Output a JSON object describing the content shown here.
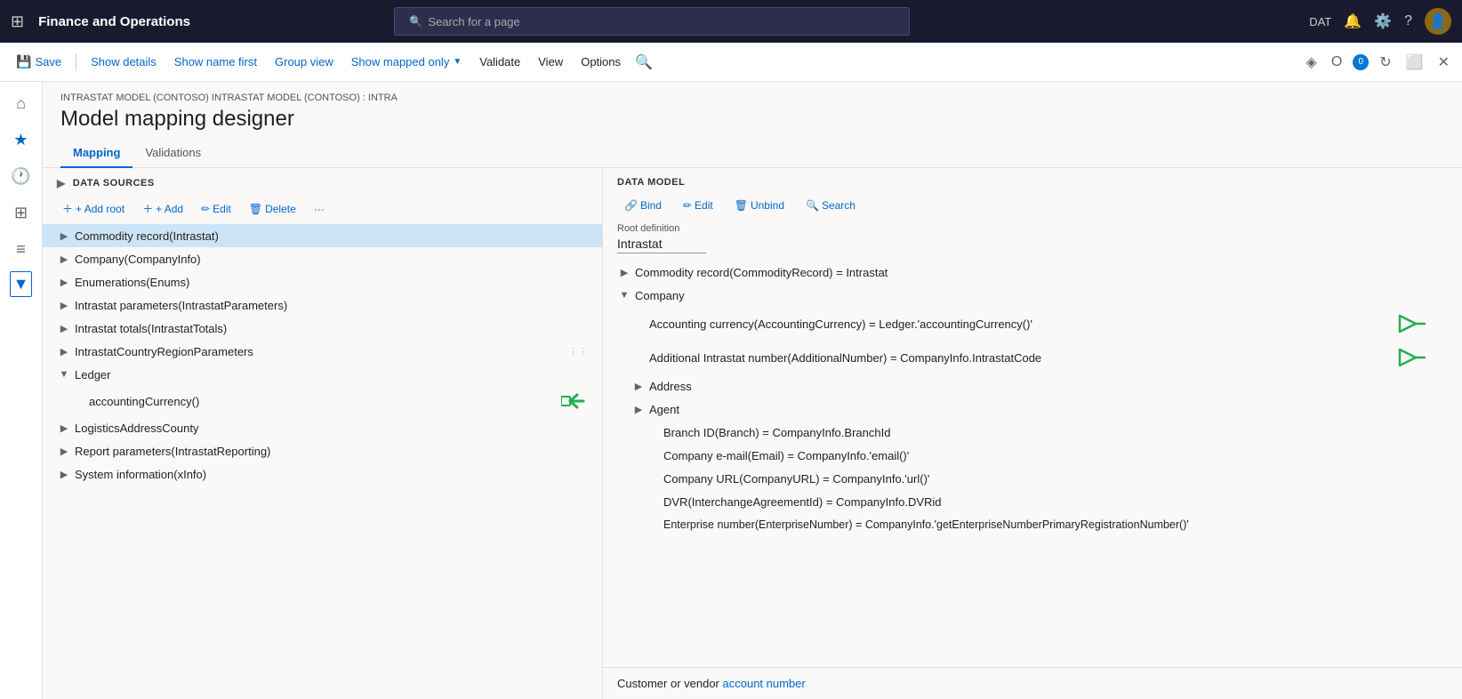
{
  "app": {
    "title": "Finance and Operations",
    "search_placeholder": "Search for a page",
    "env": "DAT"
  },
  "toolbar": {
    "save_label": "Save",
    "show_details_label": "Show details",
    "show_name_first_label": "Show name first",
    "group_view_label": "Group view",
    "show_mapped_only_label": "Show mapped only",
    "validate_label": "Validate",
    "view_label": "View",
    "options_label": "Options"
  },
  "page": {
    "breadcrumb": "INTRASTAT MODEL (CONTOSO) INTRASTAT MODEL (CONTOSO) : INTRA",
    "title": "Model mapping designer",
    "tabs": [
      {
        "label": "Mapping",
        "active": true
      },
      {
        "label": "Validations",
        "active": false
      }
    ]
  },
  "data_sources": {
    "header": "DATA SOURCES",
    "actions": {
      "add_root": "+ Add root",
      "add": "+ Add",
      "edit": "Edit",
      "delete": "Delete"
    },
    "items": [
      {
        "id": "commodity",
        "label": "Commodity record(Intrastat)",
        "level": 0,
        "expanded": false,
        "selected": true
      },
      {
        "id": "company",
        "label": "Company(CompanyInfo)",
        "level": 0,
        "expanded": false,
        "selected": false
      },
      {
        "id": "enumerations",
        "label": "Enumerations(Enums)",
        "level": 0,
        "expanded": false,
        "selected": false
      },
      {
        "id": "intrastat_params",
        "label": "Intrastat parameters(IntrastatParameters)",
        "level": 0,
        "expanded": false,
        "selected": false
      },
      {
        "id": "intrastat_totals",
        "label": "Intrastat totals(IntrastatTotals)",
        "level": 0,
        "expanded": false,
        "selected": false
      },
      {
        "id": "intrastat_country",
        "label": "IntrastatCountryRegionParameters",
        "level": 0,
        "expanded": false,
        "selected": false
      },
      {
        "id": "ledger",
        "label": "Ledger",
        "level": 0,
        "expanded": true,
        "selected": false
      },
      {
        "id": "accounting_currency",
        "label": "accountingCurrency()",
        "level": 1,
        "expanded": false,
        "selected": false,
        "has_arrow": true
      },
      {
        "id": "logistics_address",
        "label": "LogisticsAddressCounty",
        "level": 0,
        "expanded": false,
        "selected": false
      },
      {
        "id": "report_params",
        "label": "Report parameters(IntrastatReporting)",
        "level": 0,
        "expanded": false,
        "selected": false
      },
      {
        "id": "system_info",
        "label": "System information(xInfo)",
        "level": 0,
        "expanded": false,
        "selected": false
      }
    ]
  },
  "data_model": {
    "header": "DATA MODEL",
    "actions": {
      "bind_label": "Bind",
      "edit_label": "Edit",
      "unbind_label": "Unbind",
      "search_label": "Search"
    },
    "root_def_label": "Root definition",
    "root_def_value": "Intrastat",
    "items": [
      {
        "id": "commodity_record",
        "label": "Commodity record(CommodityRecord) = Intrastat",
        "level": 0,
        "expanded": false
      },
      {
        "id": "company_group",
        "label": "Company",
        "level": 0,
        "expanded": true
      },
      {
        "id": "accounting_currency",
        "label": "Accounting currency(AccountingCurrency) = Ledger.'accountingCurrency()'",
        "level": 1,
        "has_arrow": true
      },
      {
        "id": "additional_intrastat",
        "label": "Additional Intrastat number(AdditionalNumber) = CompanyInfo.IntrastatCode",
        "level": 1,
        "has_arrow": true
      },
      {
        "id": "address",
        "label": "Address",
        "level": 1,
        "expanded": false
      },
      {
        "id": "agent",
        "label": "Agent",
        "level": 1,
        "expanded": false
      },
      {
        "id": "branch_id",
        "label": "Branch ID(Branch) = CompanyInfo.BranchId",
        "level": 2
      },
      {
        "id": "company_email",
        "label": "Company e-mail(Email) = CompanyInfo.'email()'",
        "level": 2
      },
      {
        "id": "company_url",
        "label": "Company URL(CompanyURL) = CompanyInfo.'url()'",
        "level": 2
      },
      {
        "id": "dvr",
        "label": "DVR(InterchangeAgreementId) = CompanyInfo.DVRid",
        "level": 2
      },
      {
        "id": "enterprise_number",
        "label": "Enterprise number(EnterpriseNumber) = CompanyInfo.'getEnterpriseNumberPrimaryRegistrationNumber()'",
        "level": 2
      }
    ],
    "bottom_text_parts": [
      "Customer or vendor account number"
    ]
  }
}
